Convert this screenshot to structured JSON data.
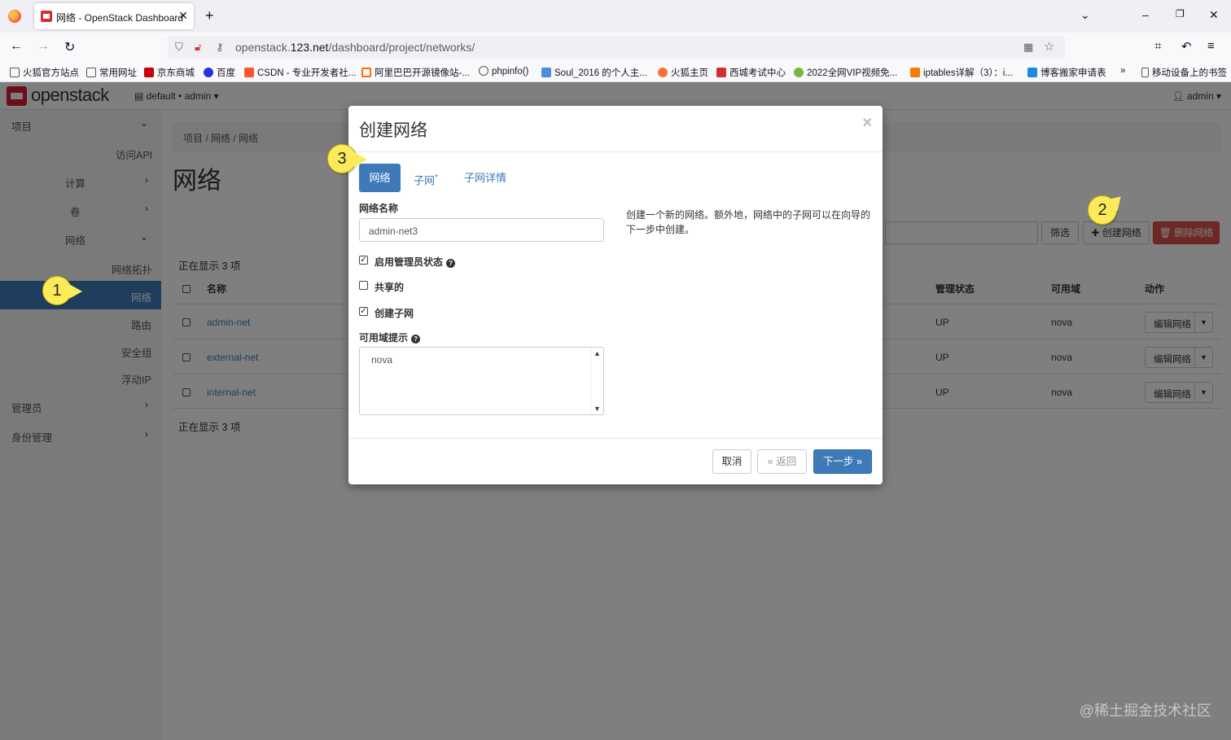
{
  "browser": {
    "tab_title": "网络 - OpenStack Dashboard",
    "url_prefix": "openstack.",
    "url_host": "123.net",
    "url_path": "/dashboard/project/networks/",
    "bookmarks": [
      "火狐官方站点",
      "常用网址",
      "京东商城",
      "百度",
      "CSDN - 专业开发者社...",
      "阿里巴巴开源镜像站-...",
      "phpinfo()",
      "Soul_2016 的个人主...",
      "火狐主页",
      "西城考试中心",
      "2022全网VIP视频免...",
      "iptables详解（3）：i...",
      "博客搬家申请表",
      "移动设备上的书签"
    ]
  },
  "header": {
    "brand": "openstack",
    "project_selector": "default • admin",
    "user": "admin"
  },
  "sidebar": {
    "items": [
      {
        "label": "项目"
      },
      {
        "label": "访问API"
      },
      {
        "label": "计算"
      },
      {
        "label": "卷"
      },
      {
        "label": "网络"
      },
      {
        "label": "网络拓扑"
      },
      {
        "label": "网络"
      },
      {
        "label": "路由"
      },
      {
        "label": "安全组"
      },
      {
        "label": "浮动IP"
      },
      {
        "label": "管理员"
      },
      {
        "label": "身份管理"
      }
    ]
  },
  "main": {
    "breadcrumb": "项目 /   网络 /   网络",
    "title": "网络",
    "filter_label": "筛选",
    "create_label": "创建网络",
    "delete_label": "删除网络",
    "showing_top": "正在显示 3 项",
    "showing_bottom": "正在显示 3 项",
    "columns": {
      "name": "名称",
      "admin_state": "管理状态",
      "az": "可用域",
      "actions": "动作"
    },
    "rows": [
      {
        "name": "admin-net",
        "admin_state": "UP",
        "az": "nova",
        "action": "编辑网络"
      },
      {
        "name": "external-net",
        "admin_state": "UP",
        "az": "nova",
        "action": "编辑网络"
      },
      {
        "name": "internal-net",
        "admin_state": "UP",
        "az": "nova",
        "action": "编辑网络"
      }
    ]
  },
  "modal": {
    "title": "创建网络",
    "tabs": [
      "网络",
      "子网",
      "子网详情"
    ],
    "tab_required_mark": "*",
    "network_name_label": "网络名称",
    "network_name_value": "admin-net3",
    "admin_state_label": "启用管理员状态",
    "shared_label": "共享的",
    "create_subnet_label": "创建子网",
    "az_hint_label": "可用域提示",
    "az_hint_value": "nova",
    "help_text": "创建一个新的网络。额外地，网络中的子网可以在向导的下一步中创建。",
    "cancel": "取消",
    "back": "返回",
    "next": "下一步",
    "admin_state_checked": true,
    "shared_checked": false,
    "create_subnet_checked": true
  },
  "annotations": {
    "callout_1": "1",
    "callout_2": "2",
    "callout_3": "3"
  },
  "watermark": "@稀土掘金技术社区",
  "colors": {
    "primary": "#3f7ab8",
    "danger": "#d9534f",
    "callout": "#fbeb5b",
    "brand": "#da1a32"
  }
}
